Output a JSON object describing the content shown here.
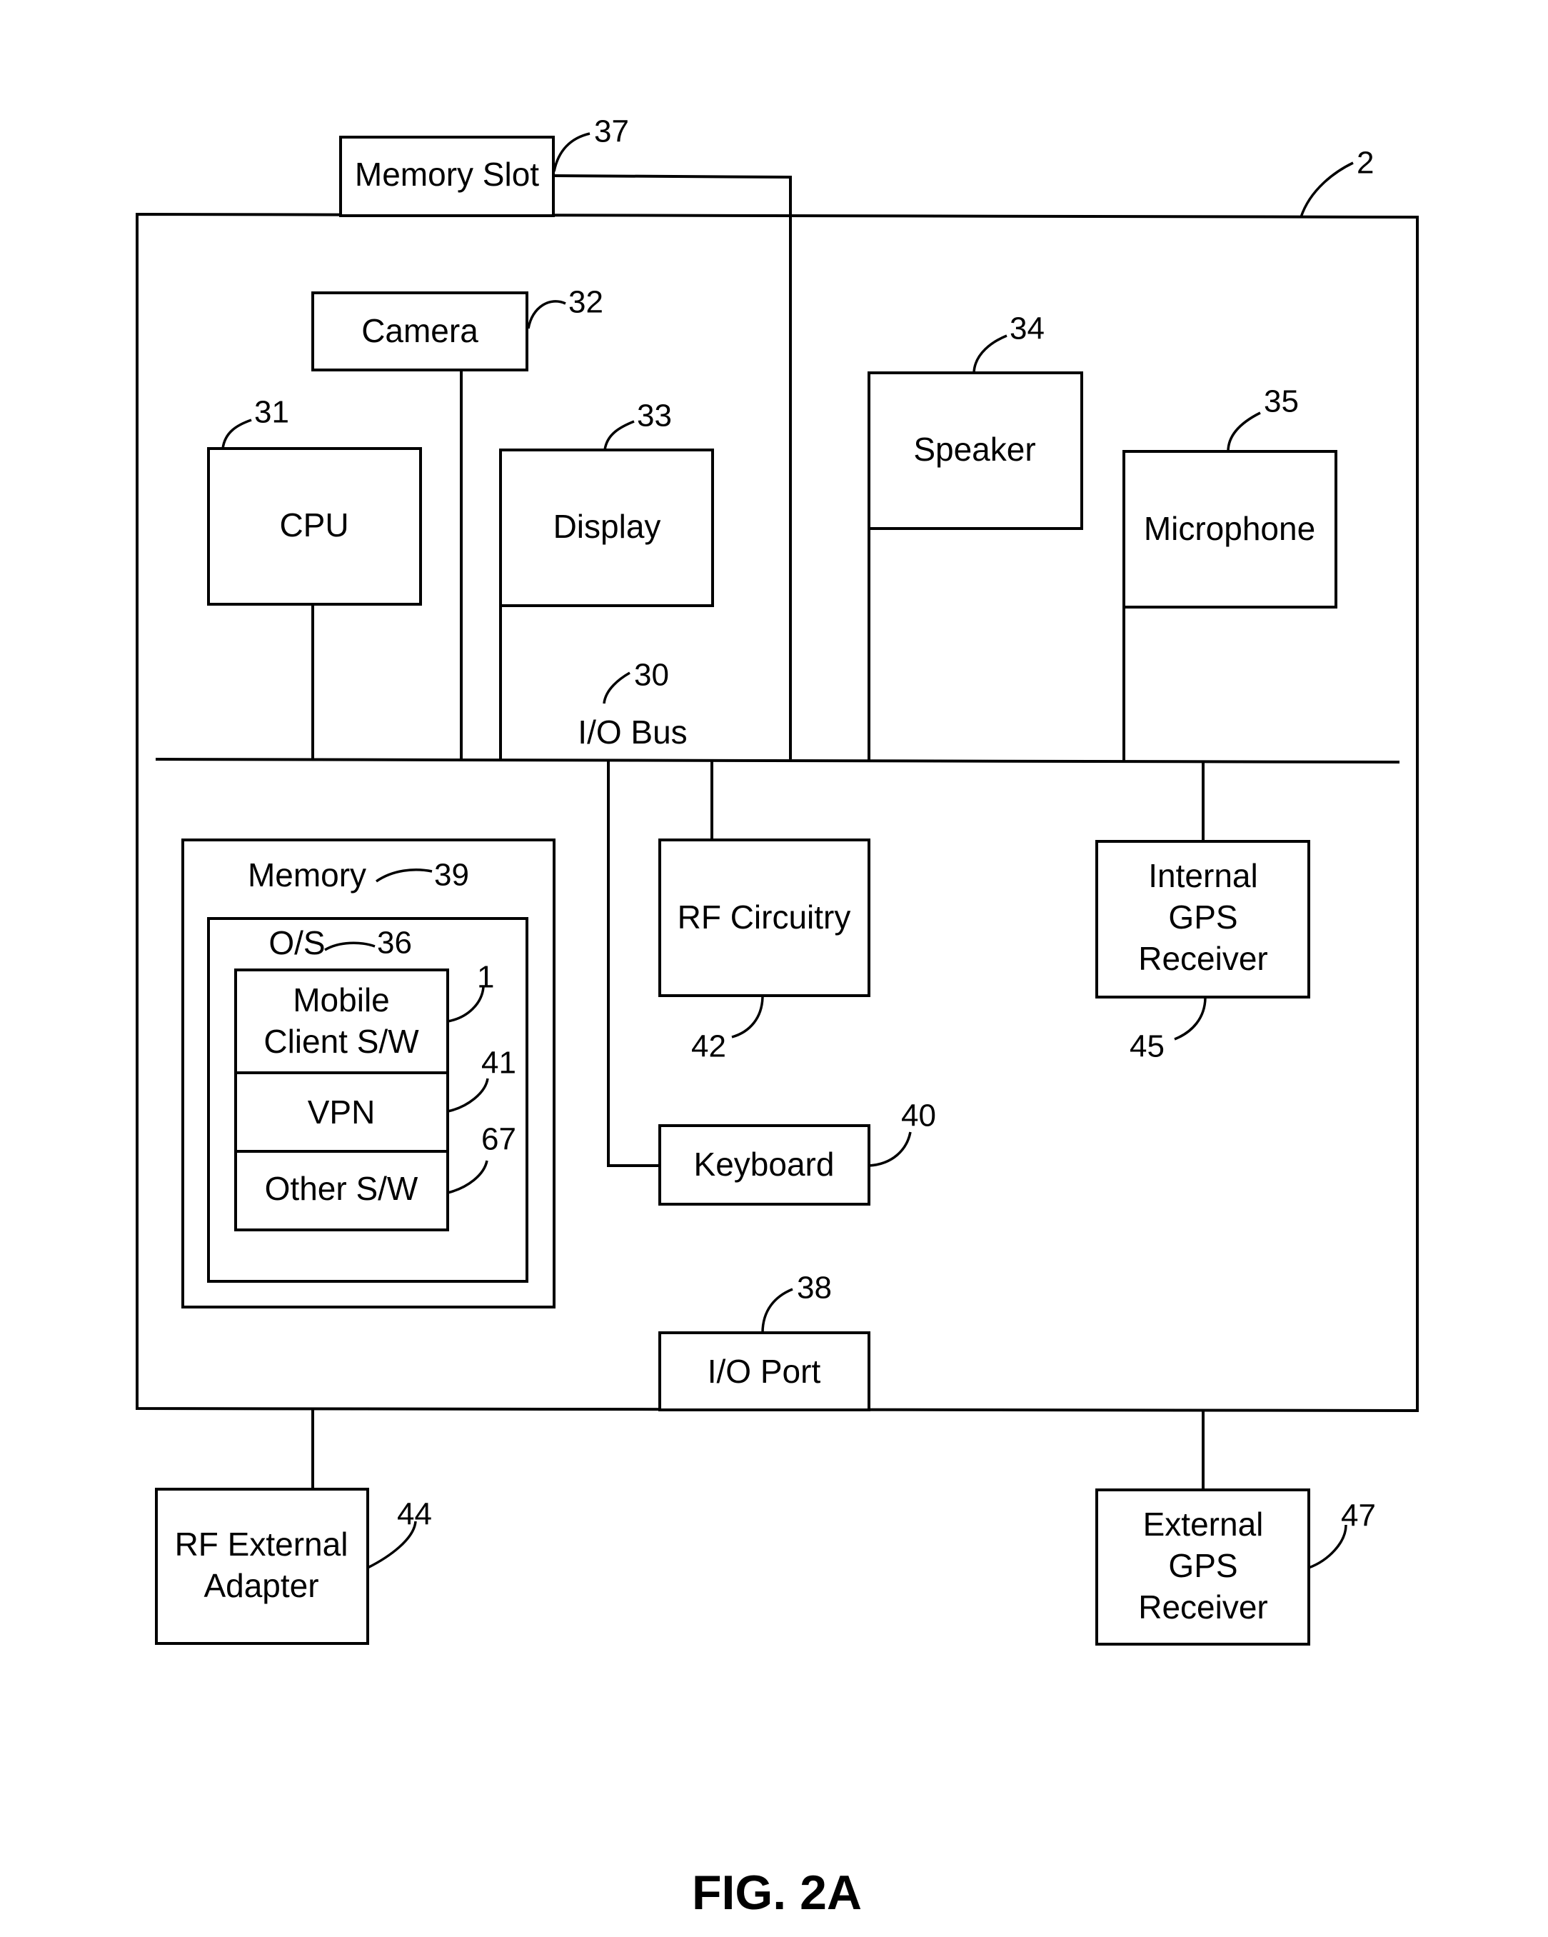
{
  "figure": {
    "caption": "FIG. 2A",
    "device_ref": "2"
  },
  "components": {
    "memory_slot": {
      "label": "Memory Slot",
      "ref": "37"
    },
    "camera": {
      "label": "Camera",
      "ref": "32"
    },
    "cpu": {
      "label": "CPU",
      "ref": "31"
    },
    "display": {
      "label": "Display",
      "ref": "33"
    },
    "speaker": {
      "label": "Speaker",
      "ref": "34"
    },
    "microphone": {
      "label": "Microphone",
      "ref": "35"
    },
    "io_bus": {
      "label": "I/O Bus",
      "ref": "30"
    },
    "memory": {
      "label": "Memory",
      "ref": "39"
    },
    "os": {
      "label": "O/S",
      "ref": "36"
    },
    "mobile_client": {
      "label_line1": "Mobile",
      "label_line2": "Client S/W",
      "ref": "1"
    },
    "vpn": {
      "label": "VPN",
      "ref": "41"
    },
    "other_sw": {
      "label": "Other S/W",
      "ref": "67"
    },
    "rf_circuitry": {
      "label": "RF Circuitry",
      "ref": "42"
    },
    "internal_gps": {
      "label_line1": "Internal",
      "label_line2": "GPS",
      "label_line3": "Receiver",
      "ref": "45"
    },
    "keyboard": {
      "label": "Keyboard",
      "ref": "40"
    },
    "io_port": {
      "label": "I/O Port",
      "ref": "38"
    },
    "rf_external_adapter": {
      "label_line1": "RF External",
      "label_line2": "Adapter",
      "ref": "44"
    },
    "external_gps": {
      "label_line1": "External",
      "label_line2": "GPS",
      "label_line3": "Receiver",
      "ref": "47"
    }
  }
}
